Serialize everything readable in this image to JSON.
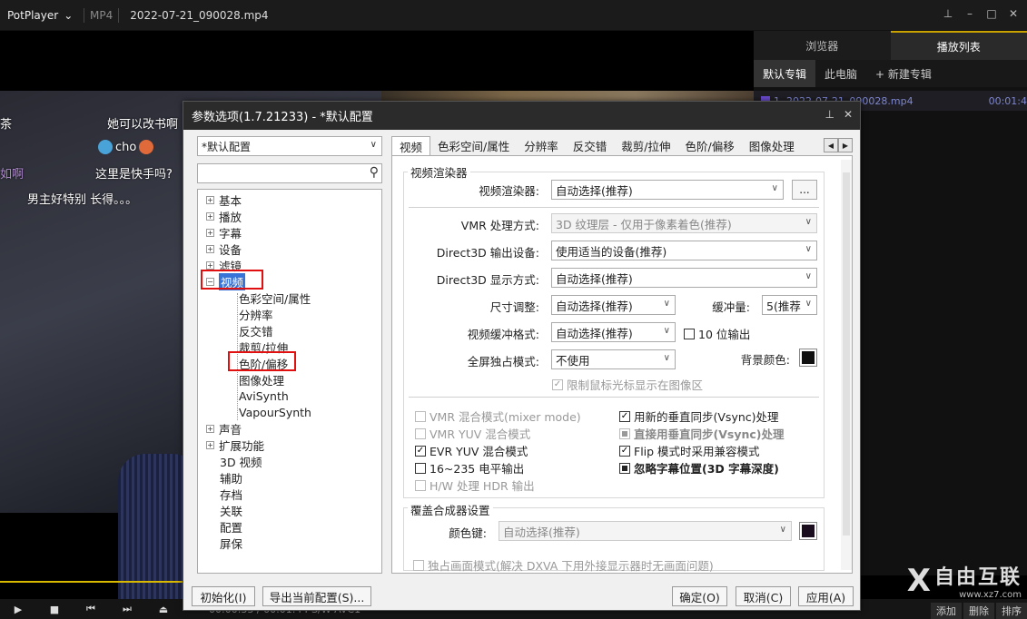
{
  "app": {
    "brand": "PotPlayer",
    "format": "MP4",
    "filename": "2022-07-21_090028.mp4"
  },
  "chat": [
    {
      "text": "她可以改书啊"
    },
    {
      "text": "cho"
    },
    {
      "text": "这里是快手吗?"
    },
    {
      "text": "男主好特别 长得。。。"
    },
    {
      "text": "茶"
    },
    {
      "text": "如啊"
    }
  ],
  "playlist": {
    "tabs": [
      "浏览器",
      "播放列表"
    ],
    "subtabs": [
      "默认专辑",
      "此电脑",
      "+ 新建专辑"
    ],
    "item": "1. 2022-07-21_090028.mp4",
    "item_time": "00:01:4",
    "bottom_buttons": [
      "添加",
      "删除",
      "排序"
    ]
  },
  "player": {
    "time": "00:00:33 / 00:01:44  S/W  AVC1"
  },
  "dialog": {
    "title": "参数选项(1.7.21233) - *默认配置",
    "preset": "*默认配置",
    "search_placeholder": "",
    "tree": [
      {
        "label": "基本",
        "type": "collapsed"
      },
      {
        "label": "播放",
        "type": "collapsed"
      },
      {
        "label": "字幕",
        "type": "collapsed"
      },
      {
        "label": "设备",
        "type": "collapsed"
      },
      {
        "label": "滤镜",
        "type": "collapsed"
      },
      {
        "label": "视频",
        "type": "expanded"
      },
      {
        "label": "色彩空间/属性",
        "type": "child"
      },
      {
        "label": "分辨率",
        "type": "child"
      },
      {
        "label": "反交错",
        "type": "child"
      },
      {
        "label": "裁剪/拉伸",
        "type": "child"
      },
      {
        "label": "色阶/偏移",
        "type": "child"
      },
      {
        "label": "图像处理",
        "type": "child"
      },
      {
        "label": "AviSynth",
        "type": "child"
      },
      {
        "label": "VapourSynth",
        "type": "child"
      },
      {
        "label": "声音",
        "type": "collapsed"
      },
      {
        "label": "扩展功能",
        "type": "collapsed"
      },
      {
        "label": "3D 视频",
        "type": "leaf"
      },
      {
        "label": "辅助",
        "type": "leaf"
      },
      {
        "label": "存档",
        "type": "leaf"
      },
      {
        "label": "关联",
        "type": "leaf"
      },
      {
        "label": "配置",
        "type": "leaf"
      },
      {
        "label": "屏保",
        "type": "leaf"
      }
    ],
    "tabs": [
      "视频",
      "色彩空间/属性",
      "分辨率",
      "反交错",
      "裁剪/拉伸",
      "色阶/偏移",
      "图像处理"
    ],
    "renderer_group": {
      "title": "视频渲染器",
      "renderer_label": "视频渲染器:",
      "renderer_value": "自动选择(推荐)",
      "dots": "...",
      "vmr_label": "VMR 处理方式:",
      "vmr_value": "3D 纹理层 - 仅用于像素着色(推荐)",
      "d3d_out_label": "Direct3D 输出设备:",
      "d3d_out_value": "使用适当的设备(推荐)",
      "d3d_disp_label": "Direct3D 显示方式:",
      "d3d_disp_value": "自动选择(推荐)",
      "size_label": "尺寸调整:",
      "size_value": "自动选择(推荐)",
      "buffer_label": "缓冲量:",
      "buffer_value": "5(推荐",
      "buf_fmt_label": "视频缓冲格式:",
      "buf_fmt_value": "自动选择(推荐)",
      "tenbit": "10 位输出",
      "fullscreen_label": "全屏独占模式:",
      "fullscreen_value": "不使用",
      "bgcolor_label": "背景颜色:",
      "limit_cursor": "限制鼠标光标显示在图像区"
    },
    "options": {
      "vmr_mixer": "VMR 混合模式(mixer mode)",
      "vmr_yuv": "VMR YUV 混合模式",
      "evr_yuv": "EVR YUV 混合模式",
      "level_16_235": "16~235 电平输出",
      "hw_hdr": "H/W 处理 HDR 输出",
      "new_vsync": "用新的垂直同步(Vsync)处理",
      "direct_vsync": "直接用垂直同步(Vsync)处理",
      "flip_compat": "Flip 模式时采用兼容模式",
      "ignore_subpos": "忽略字幕位置(3D 字幕深度)"
    },
    "overlay_group": {
      "title": "覆盖合成器设置",
      "colorkey_label": "颜色键:",
      "colorkey_value": "自动选择(推荐)",
      "exclusive": "独占画面模式(解决 DXVA 下用外接显示器时无画面问题)"
    },
    "buttons": {
      "init": "初始化(I)",
      "export": "导出当前配置(S)...",
      "ok": "确定(O)",
      "cancel": "取消(C)",
      "apply": "应用(A)"
    }
  },
  "watermark": {
    "mark": "X",
    "text": "自由互联",
    "url": "www.xz7.com"
  },
  "colors": {
    "seek": "#d9b800",
    "highlight": "#e01010",
    "selection": "#3874d8"
  }
}
